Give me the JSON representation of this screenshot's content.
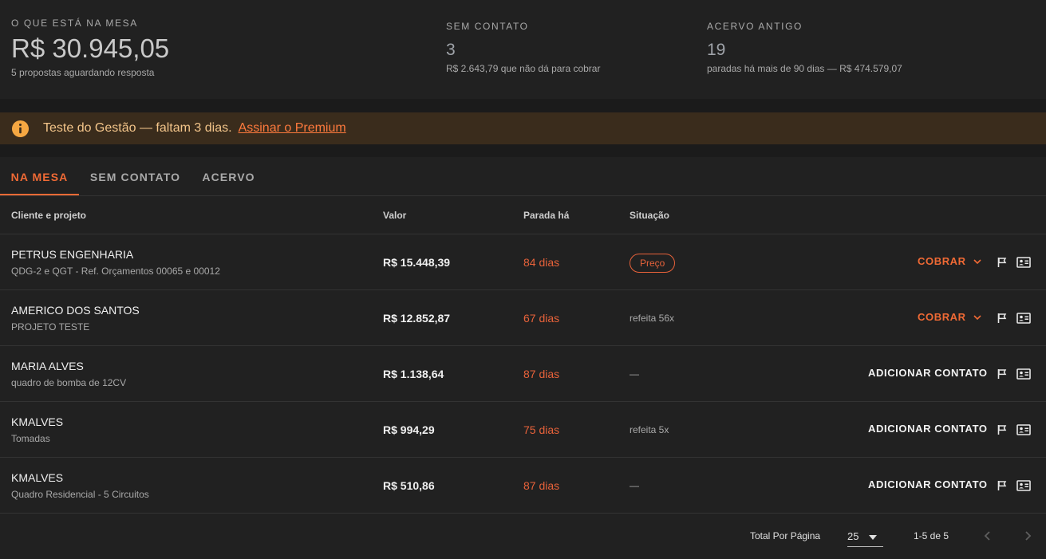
{
  "summary": {
    "on_table": {
      "caption": "O QUE ESTÁ NA MESA",
      "value": "R$ 30.945,05",
      "sub": "5 propostas aguardando resposta"
    },
    "no_contact": {
      "caption": "SEM CONTATO",
      "value": "3",
      "sub": "R$ 2.643,79 que não dá para cobrar"
    },
    "old_archive": {
      "caption": "ACERVO ANTIGO",
      "value": "19",
      "sub": "paradas há mais de 90 dias — R$ 474.579,07"
    }
  },
  "banner": {
    "icon": "info-icon",
    "text": "Teste do Gestão — faltam 3 dias.",
    "link": "Assinar o Premium"
  },
  "tabs": [
    "NA MESA",
    "SEM CONTATO",
    "ACERVO"
  ],
  "active_tab": "NA MESA",
  "table": {
    "headers": {
      "client": "Cliente e projeto",
      "value": "Valor",
      "stopped": "Parada há",
      "status": "Situação"
    },
    "rows": [
      {
        "client": "PETRUS ENGENHARIA",
        "project": "QDG-2 e QGT - Ref. Orçamentos 00065 e 00012",
        "value": "R$ 15.448,39",
        "stopped": "84 dias",
        "status": "Preço",
        "action": "COBRAR"
      },
      {
        "client": "AMERICO DOS SANTOS",
        "project": "PROJETO TESTE",
        "value": "R$ 12.852,87",
        "stopped": "67 dias",
        "status": "refeita 56x",
        "action": "COBRAR"
      },
      {
        "client": "MARIA ALVES",
        "project": "quadro de bomba de 12CV",
        "value": "R$ 1.138,64",
        "stopped": "87 dias",
        "status": "—",
        "action": "ADICIONAR CONTATO"
      },
      {
        "client": "KMALVES",
        "project": "Tomadas",
        "value": "R$ 994,29",
        "stopped": "75 dias",
        "status": "refeita 5x",
        "action": "ADICIONAR CONTATO"
      },
      {
        "client": "KMALVES",
        "project": "Quadro Residencial - 5 Circuitos",
        "value": "R$ 510,86",
        "stopped": "87 dias",
        "status": "—",
        "action": "ADICIONAR CONTATO"
      }
    ]
  },
  "pagination": {
    "label": "Total Por Página",
    "per_page": "25",
    "range": "1-5 de 5"
  },
  "colors": {
    "accent": "#f06a35",
    "banner_bg": "#3a2c1c",
    "banner_text": "#f3c58a",
    "info_icon": "#f5a742"
  }
}
